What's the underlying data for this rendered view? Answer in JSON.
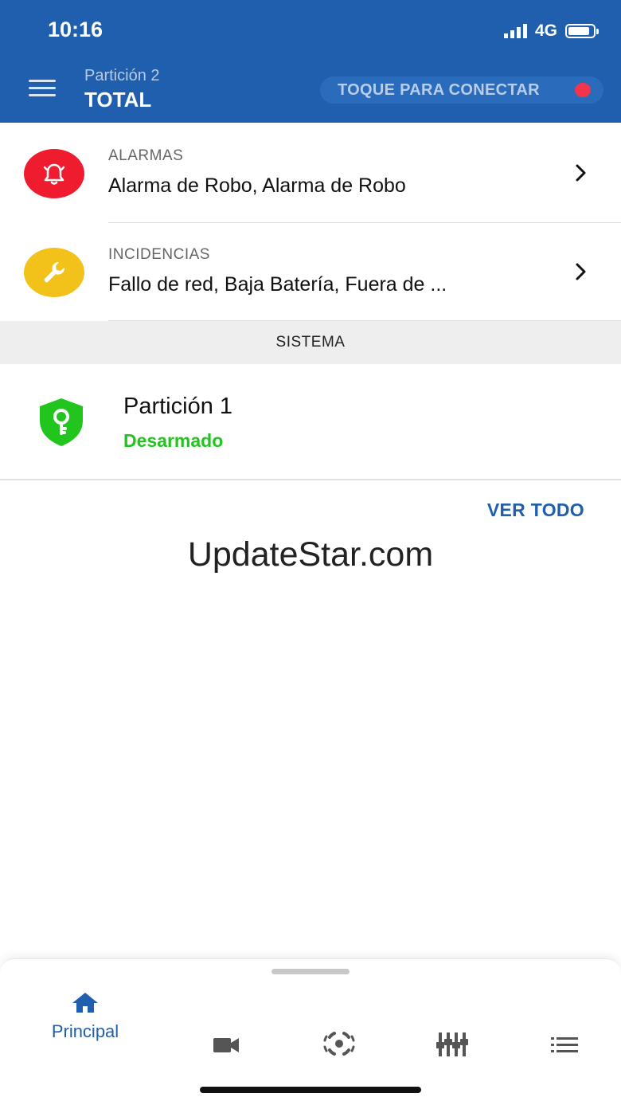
{
  "status_bar": {
    "time": "10:16",
    "network": "4G"
  },
  "header": {
    "subtitle": "Partición 2",
    "title": "TOTAL",
    "connect_label": "TOQUE PARA CONECTAR",
    "connect_dot_color": "#f2354a"
  },
  "alarms": {
    "category": "ALARMAS",
    "description": "Alarma de Robo, Alarma de Robo",
    "icon": "bell-icon",
    "color": "#ee1c2e"
  },
  "incidents": {
    "category": "INCIDENCIAS",
    "description": "Fallo de red, Baja Batería, Fuera de ...",
    "icon": "wrench-icon",
    "color": "#f2c21a"
  },
  "section": {
    "title": "SISTEMA"
  },
  "partition": {
    "name": "Partición 1",
    "state": "Desarmado",
    "state_color": "#22c51e",
    "icon": "shield-key-icon"
  },
  "ver_todo": "VER TODO",
  "watermark": "UpdateStar.com",
  "tabs": [
    {
      "name": "home",
      "label": "Principal",
      "icon": "home-icon",
      "active": true
    },
    {
      "name": "camera",
      "icon": "video-camera-icon"
    },
    {
      "name": "sensors",
      "icon": "sensor-icon"
    },
    {
      "name": "controls",
      "icon": "sliders-icon"
    },
    {
      "name": "list",
      "icon": "list-icon"
    }
  ],
  "colors": {
    "primary": "#1f5fae",
    "alarm": "#ee1c2e",
    "warning": "#f2c21a",
    "ok": "#22c51e"
  }
}
